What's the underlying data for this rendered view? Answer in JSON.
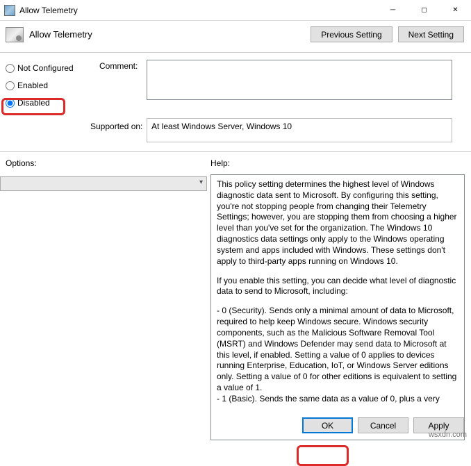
{
  "window": {
    "title": "Allow Telemetry"
  },
  "header": {
    "policy_name": "Allow Telemetry",
    "previous_btn": "Previous Setting",
    "next_btn": "Next Setting"
  },
  "radios": {
    "not_configured": "Not Configured",
    "enabled": "Enabled",
    "disabled": "Disabled",
    "selected": "disabled"
  },
  "labels": {
    "comment": "Comment:",
    "supported_on": "Supported on:",
    "options": "Options:",
    "help": "Help:"
  },
  "fields": {
    "comment_value": "",
    "supported_value": "At least Windows Server, Windows 10",
    "options_value": ""
  },
  "help_text": {
    "p1": "This policy setting determines the highest level of Windows diagnostic data sent to Microsoft. By configuring this setting, you're not stopping people from changing their Telemetry Settings; however, you are stopping them from choosing a higher level than you've set for the organization. The Windows 10 diagnostics data settings only apply to the Windows operating system and apps included with Windows. These settings don't apply to third-party apps running on Windows 10.",
    "p2": "If you enable this setting, you can decide what level of diagnostic data to send to Microsoft, including:",
    "p3": " - 0 (Security). Sends only a minimal amount of data to Microsoft, required to help keep Windows secure. Windows security components, such as the Malicious Software Removal Tool (MSRT) and Windows Defender may send data to Microsoft at this level, if enabled. Setting a value of 0 applies to devices running Enterprise, Education, IoT, or Windows Server editions only. Setting a value of 0 for other editions is equivalent to setting a value of 1.",
    "p4": " - 1 (Basic). Sends the same data as a value of 0, plus a very"
  },
  "footer": {
    "ok": "OK",
    "cancel": "Cancel",
    "apply": "Apply"
  },
  "watermark": "wsxdn.com"
}
